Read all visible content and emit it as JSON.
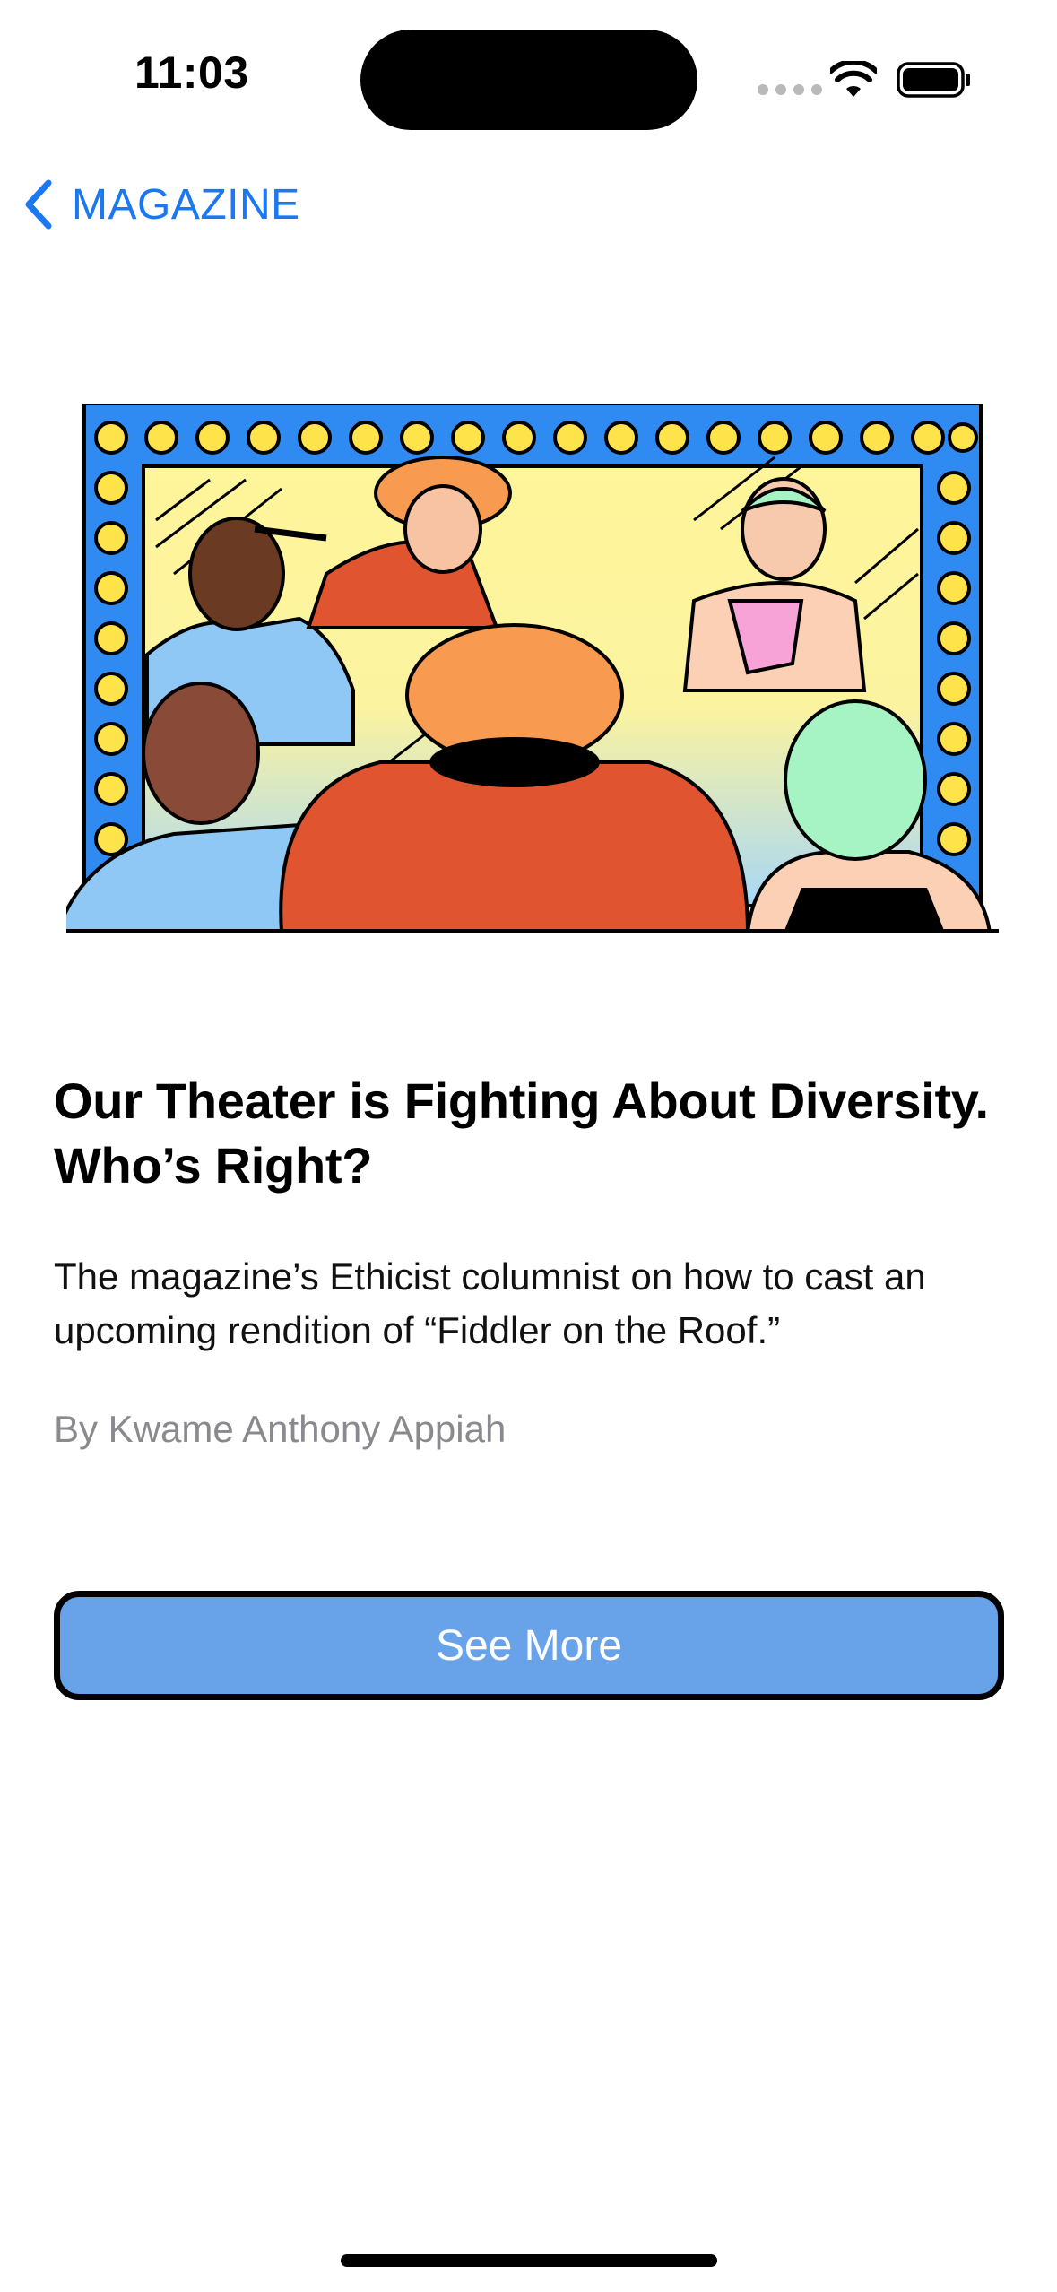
{
  "status_bar": {
    "time": "11:03"
  },
  "nav": {
    "back_label": "MAGAZINE",
    "accent_color": "#1a78f2"
  },
  "article": {
    "title": "Our Theater is Fighting About Diversity. Who’s Right?",
    "subtitle": "The magazine’s Ethicist columnist on how to cast an upcoming rendition of “Fiddler on the Roof.”",
    "byline": "By Kwame Anthony Appiah",
    "illustration_icon": "theater-dressing-room-mirror-illustration"
  },
  "actions": {
    "see_more_label": "See More",
    "button_color": "#68a3ea"
  }
}
